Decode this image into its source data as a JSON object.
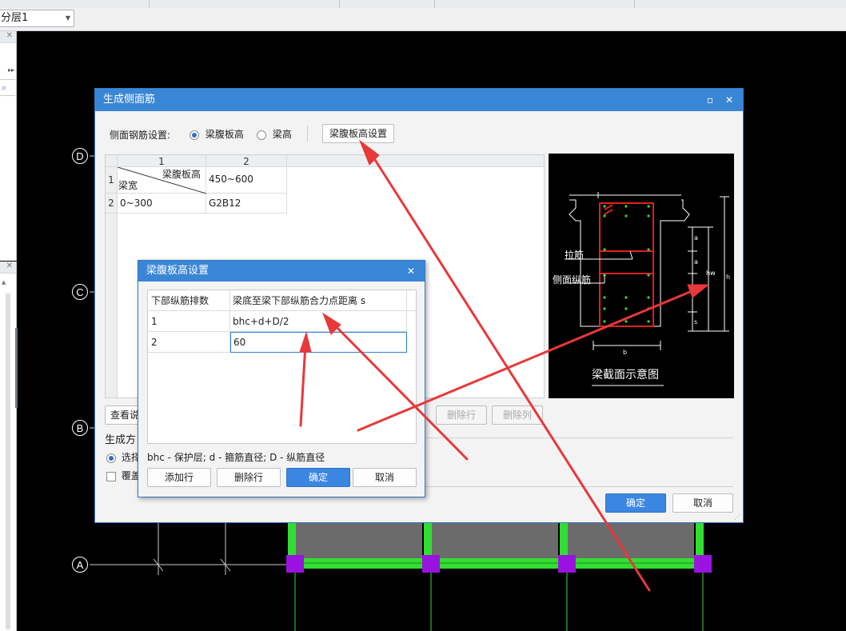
{
  "floor_select": {
    "value": "分层1"
  },
  "axes": {
    "d": "D",
    "c": "C",
    "b": "B",
    "a": "A"
  },
  "main_dialog": {
    "title": "生成侧面筋",
    "setting_label": "侧面钢筋设置:",
    "radio_web_height": "梁腹板高",
    "radio_beam_height": "梁高",
    "web_height_setting_button": "梁腹板高设置",
    "grid": {
      "col_headers": [
        "1",
        "2"
      ],
      "row_headers": [
        "1",
        "2"
      ],
      "diag_top": "梁腹板高",
      "diag_bottom": "梁宽",
      "header_value": "450~600",
      "row2_col1": "0~300",
      "row2_col2": "G2B12"
    },
    "view_button": "查看说",
    "delete_row_button": "删除行",
    "delete_col_button": "删除列",
    "gen_mode_label": "生成方",
    "select_label": "选择",
    "overwrite_label": "覆盖",
    "ok_button": "确定",
    "cancel_button": "取消",
    "diagram": {
      "tie_label": "拉筋",
      "side_long_label": "侧面纵筋",
      "caption": "梁截面示意图",
      "dim_b": "b",
      "dim_a1": "a",
      "dim_a2": "a",
      "dim_s": "s",
      "dim_hw": "hw",
      "dim_h": "h"
    }
  },
  "sub_dialog": {
    "title": "梁腹板高设置",
    "col1_header": "下部纵筋排数",
    "col2_header": "梁底至梁下部纵筋合力点距离 s",
    "rows": [
      {
        "count": "1",
        "distance": "bhc+d+D/2"
      },
      {
        "count": "2",
        "distance": "60"
      }
    ],
    "legend": "bhc - 保护层;  d - 箍筋直径;  D - 纵筋直径",
    "add_row_button": "添加行",
    "delete_row_button": "删除行",
    "ok_button": "确定",
    "cancel_button": "取消"
  },
  "colors": {
    "accent": "#3a86d6",
    "annotation_arrow": "#e8383a",
    "beam_green": "#33dd33",
    "column_purple": "#9a12e0"
  }
}
